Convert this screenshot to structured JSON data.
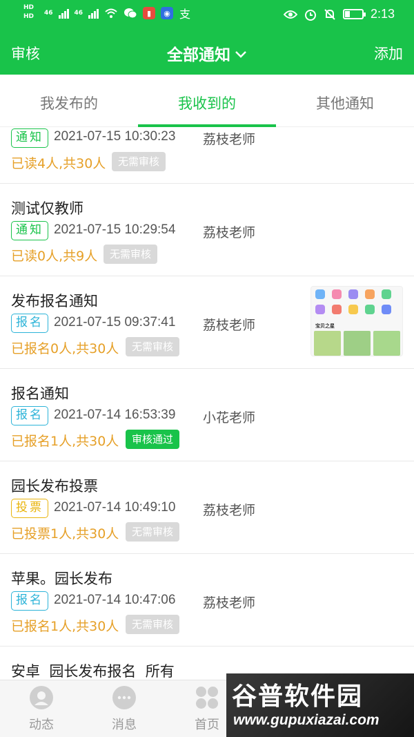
{
  "status_bar": {
    "hd_top": "HD",
    "hd_bottom": "HD",
    "network": "46",
    "network2": "46",
    "time": "2:13"
  },
  "header": {
    "left_label": "审核",
    "title": "全部通知",
    "right_label": "添加"
  },
  "tabs": [
    {
      "label": "我发布的",
      "active": false
    },
    {
      "label": "我收到的",
      "active": true
    },
    {
      "label": "其他通知",
      "active": false
    }
  ],
  "items": [
    {
      "title": "",
      "tag": "通知",
      "time": "2021-07-15 10:30:23",
      "teacher": "荔枝老师",
      "stat": "已读4人,共30人",
      "badge": "无需审核"
    },
    {
      "title": "测试仅教师",
      "tag": "通知",
      "time": "2021-07-15 10:29:54",
      "teacher": "荔枝老师",
      "stat": "已读0人,共9人",
      "badge": "无需审核"
    },
    {
      "title": "发布报名通知",
      "tag": "报名",
      "time": "2021-07-15 09:37:41",
      "teacher": "荔枝老师",
      "stat": "已报名0人,共30人",
      "badge": "无需审核",
      "thumb_label": "宝贝之星"
    },
    {
      "title": "报名通知",
      "tag": "报名",
      "time": "2021-07-14 16:53:39",
      "teacher": "小花老师",
      "stat": "已报名1人,共30人",
      "badge": "审核通过"
    },
    {
      "title": "园长发布投票",
      "tag": "投票",
      "time": "2021-07-14 10:49:10",
      "teacher": "荔枝老师",
      "stat": "已投票1人,共30人",
      "badge": "无需审核"
    },
    {
      "title": "苹果。园长发布",
      "tag": "报名",
      "time": "2021-07-14 10:47:06",
      "teacher": "荔枝老师",
      "stat": "已报名1人,共30人",
      "badge": "无需审核"
    },
    {
      "title": "安卓  园长发布报名  所有"
    }
  ],
  "bottom_nav": [
    {
      "label": "动态",
      "icon": "dynamic-icon"
    },
    {
      "label": "消息",
      "icon": "message-icon"
    },
    {
      "label": "首页",
      "icon": "home-grid-icon"
    }
  ],
  "watermark": {
    "title": "谷普软件园",
    "url": "www.gupuxiazai.com"
  },
  "colors": {
    "brand_green": "#19c34a",
    "stat_orange": "#e6a028",
    "tag_blue": "#2bb3d8",
    "tag_yellow": "#e9b40c",
    "badge_grey": "#d9d9d9"
  }
}
